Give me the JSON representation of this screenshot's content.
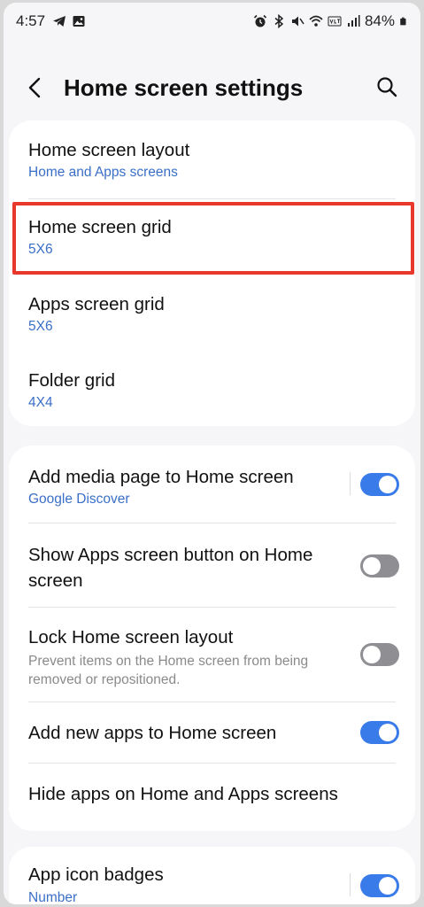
{
  "status_bar": {
    "time": "4:57",
    "battery": "84%"
  },
  "header": {
    "title": "Home screen settings"
  },
  "section1": {
    "items": [
      {
        "title": "Home screen layout",
        "subtitle": "Home and Apps screens"
      },
      {
        "title": "Home screen grid",
        "subtitle": "5X6"
      },
      {
        "title": "Apps screen grid",
        "subtitle": "5X6"
      },
      {
        "title": "Folder grid",
        "subtitle": "4X4"
      }
    ]
  },
  "section2": {
    "items": [
      {
        "title": "Add media page to Home screen",
        "subtitle": "Google Discover",
        "toggle": true
      },
      {
        "title_line1": "Show Apps screen button on Home",
        "title_line2": "screen",
        "toggle": false
      },
      {
        "title": "Lock Home screen layout",
        "desc_line1": "Prevent items on the Home screen from being",
        "desc_line2": "removed or repositioned.",
        "toggle": false
      },
      {
        "title": "Add new apps to Home screen",
        "toggle": true
      },
      {
        "title": "Hide apps on Home and Apps screens"
      }
    ]
  },
  "section3": {
    "items": [
      {
        "title": "App icon badges",
        "subtitle": "Number",
        "toggle": true
      }
    ]
  },
  "colors": {
    "accent": "#3a7bea",
    "subtitle": "#3a6fc7",
    "highlight": "#e8382b"
  }
}
